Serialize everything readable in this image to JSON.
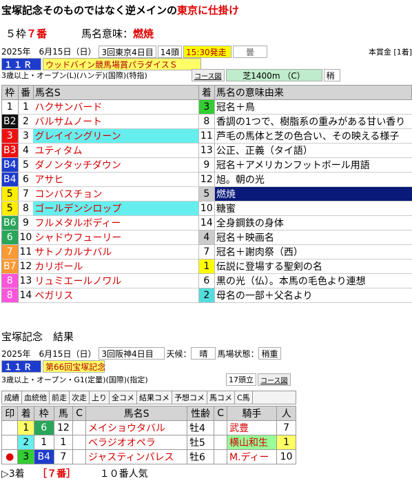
{
  "headline": {
    "prefix": "宝塚記念そのものではなく逆メインの",
    "highlight": "東京に仕掛け"
  },
  "summary": {
    "waku": "５枠",
    "horse_no": "７番",
    "meaning_label": "馬名意味：",
    "meaning_value": "燃焼"
  },
  "race": {
    "date": "2025年　6月15日（日）",
    "meeting": "3回東京4日目",
    "heads": "14頭",
    "post_time": "15:30発走",
    "weather_icon": "曇",
    "prize_label": "本賞金 [1着]",
    "race_no": "１１Ｒ",
    "race_name": "ウッドバイン競馬場賞パラダイスＳ",
    "conditions": "3歳以上・オープン(L)(ハンデ)(国際)(特指)",
    "course_label": "コース図",
    "course": "芝1400m （C）",
    "going": "稍"
  },
  "table": {
    "headers": {
      "waku": "枠",
      "num": "番",
      "name": "馬名S",
      "finish": "着",
      "meaning": "馬名の意味由来"
    },
    "rows": [
      {
        "waku": "1",
        "wbg": "#ffffff",
        "wfg": "#000",
        "num": "1",
        "name": "ハクサンバード",
        "nbg": "#ffffff",
        "finish": "3",
        "fbg": "#33cc33",
        "meaning": "冠名＋鳥",
        "mbg": "#ffffff",
        "mfg": "#000"
      },
      {
        "waku": "B2",
        "wbg": "#111111",
        "wfg": "#fff",
        "num": "2",
        "name": "バルサムノート",
        "nbg": "#ffffff",
        "finish": "8",
        "fbg": "#ffffff",
        "meaning": "香調の1つで、樹脂系の重みがある甘い香り",
        "mbg": "#ffffff",
        "mfg": "#000"
      },
      {
        "waku": "3",
        "wbg": "#ee1111",
        "wfg": "#fff",
        "num": "3",
        "name": "グレイイングリーン",
        "nbg": "#66eeee",
        "finish": "11",
        "fbg": "#ffffff",
        "meaning": "芦毛の馬体と芝の色合い、その映える様子",
        "mbg": "#ffffff",
        "mfg": "#000"
      },
      {
        "waku": "B3",
        "wbg": "#ee1111",
        "wfg": "#fff",
        "num": "4",
        "name": "ユティタム",
        "nbg": "#ffffff",
        "finish": "13",
        "fbg": "#ffffff",
        "meaning": "公正、正義（タイ語）",
        "mbg": "#ffffff",
        "mfg": "#000"
      },
      {
        "waku": "B4",
        "wbg": "#1e3ccc",
        "wfg": "#fff",
        "num": "5",
        "name": "ダノンタッチダウン",
        "nbg": "#ffffff",
        "finish": "9",
        "fbg": "#ffffff",
        "meaning": "冠名＋アメリカンフットボール用語",
        "mbg": "#ffffff",
        "mfg": "#000"
      },
      {
        "waku": "B4",
        "wbg": "#1e3ccc",
        "wfg": "#fff",
        "num": "6",
        "name": "アサヒ",
        "nbg": "#ffffff",
        "finish": "12",
        "fbg": "#ffffff",
        "meaning": "旭。朝の光",
        "mbg": "#ffffff",
        "mfg": "#000"
      },
      {
        "waku": "5",
        "wbg": "#ffee00",
        "wfg": "#000",
        "num": "7",
        "name": "コンバスチョン",
        "nbg": "#ffffff",
        "finish": "5",
        "fbg": "#cccccc",
        "meaning": "燃焼",
        "mbg": "#0a1a7a",
        "mfg": "#fff"
      },
      {
        "waku": "5",
        "wbg": "#ffee00",
        "wfg": "#000",
        "num": "8",
        "name": "ゴールデンシロップ",
        "nbg": "#66eeee",
        "finish": "10",
        "fbg": "#ffffff",
        "meaning": "糖蜜",
        "mbg": "#ffffff",
        "mfg": "#000"
      },
      {
        "waku": "B6",
        "wbg": "#2aa65a",
        "wfg": "#fff",
        "num": "9",
        "name": "フルメタルボディー",
        "nbg": "#ffffff",
        "finish": "14",
        "fbg": "#ffffff",
        "meaning": "全身鋼鉄の身体",
        "mbg": "#ffffff",
        "mfg": "#000"
      },
      {
        "waku": "6",
        "wbg": "#2aa65a",
        "wfg": "#fff",
        "num": "10",
        "name": "シャドウフューリー",
        "nbg": "#ffffff",
        "finish": "4",
        "fbg": "#cccccc",
        "meaning": "冠名＋映画名",
        "mbg": "#ffffff",
        "mfg": "#000"
      },
      {
        "waku": "7",
        "wbg": "#ff9933",
        "wfg": "#fff",
        "num": "11",
        "name": "サトノカルナバル",
        "nbg": "#ffffff",
        "finish": "7",
        "fbg": "#ffffff",
        "meaning": "冠名＋謝肉祭（西）",
        "mbg": "#ffffff",
        "mfg": "#000"
      },
      {
        "waku": "B7",
        "wbg": "#ff9933",
        "wfg": "#fff",
        "num": "12",
        "name": "カリボール",
        "nbg": "#ffffff",
        "finish": "1",
        "fbg": "#ffff00",
        "meaning": "伝説に登場する聖剣の名",
        "mbg": "#ffffff",
        "mfg": "#000"
      },
      {
        "waku": "8",
        "wbg": "#ff55dd",
        "wfg": "#fff",
        "num": "13",
        "name": "リュミエールノワル",
        "nbg": "#ffffff",
        "finish": "6",
        "fbg": "#ffffff",
        "meaning": "黒の光（仏）。本馬の毛色より連想",
        "mbg": "#ffffff",
        "mfg": "#000"
      },
      {
        "waku": "8",
        "wbg": "#ff55dd",
        "wfg": "#fff",
        "num": "14",
        "name": "ベガリス",
        "nbg": "#ffffff",
        "finish": "2",
        "fbg": "#55dddd",
        "meaning": "母名の一部＋父名より",
        "mbg": "#ffffff",
        "mfg": "#000"
      }
    ]
  },
  "result": {
    "section_title": "宝塚記念　結果",
    "date": "2025年　6月15日（日）",
    "meeting": "3回阪神4日目",
    "weather_label": "天候：",
    "weather": "晴",
    "track_label": "馬場状態：",
    "track": "稍重",
    "race_no": "１１Ｒ",
    "race_name": "第66回宝塚記念",
    "conditions": "3歳以上・オープン・G1(定量)(国際)(指定)",
    "heads": "17頭立",
    "course_label": "コース図",
    "tabs": [
      "成績",
      "血統他",
      "前走",
      "次走",
      "上り",
      "全コメ",
      "結果コメ",
      "予想コメ",
      "馬コメ",
      "C馬"
    ],
    "headers": [
      "印",
      "着",
      "枠",
      "馬",
      "C",
      "馬名S",
      "性齢",
      "C",
      "騎手",
      "人"
    ],
    "rows": [
      {
        "mark": "",
        "mbg": "#ffffff",
        "fin": "1",
        "finbg": "#ffff66",
        "waku": "6",
        "wbg": "#2aa65a",
        "wfg": "#fff",
        "num": "12",
        "name": "メイショウタバル",
        "sex": "牡4",
        "jockey": "武豊",
        "jbg": "#ffffff",
        "pop": "7",
        "pbg": "#ffffff"
      },
      {
        "mark": "",
        "mbg": "#ffffff",
        "fin": "2",
        "finbg": "#66eeee",
        "waku": "1",
        "wbg": "#ffffff",
        "wfg": "#000",
        "num": "1",
        "name": "ベラジオオペラ",
        "sex": "牡5",
        "jockey": "横山和生",
        "jbg": "#99ff99",
        "pop": "1",
        "pbg": "#ffff66"
      },
      {
        "mark": "●",
        "mbg": "#ffffff",
        "fin": "3",
        "finbg": "#33cc33",
        "waku": "B4",
        "wbg": "#1e3ccc",
        "wfg": "#fff",
        "num": "7",
        "name": "ジャスティンパレス",
        "sex": "牡6",
        "jockey": "M.ディー",
        "jbg": "#ffffff",
        "pop": "10",
        "pbg": "#ffffff"
      }
    ],
    "footer": {
      "left": "▷3着",
      "mid": "［７番］",
      "right": "１０番人気"
    }
  }
}
